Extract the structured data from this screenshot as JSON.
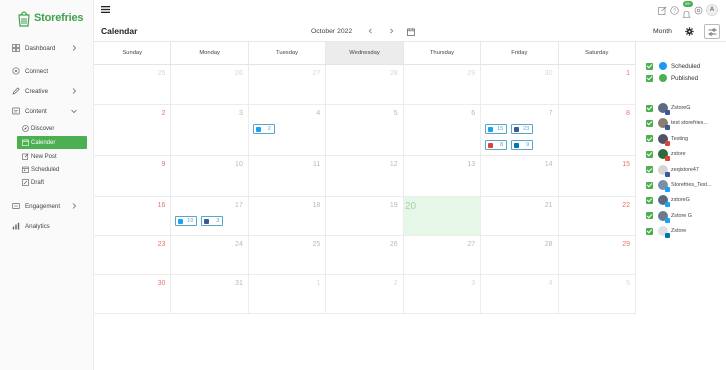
{
  "app": {
    "brand": "Storefries"
  },
  "colors": {
    "brand_green": "#4caf50",
    "weekend_red": "#e57373",
    "chip_blue": "#5aa7c4",
    "scheduled_blue": "#2196f3",
    "published_green": "#4caf50",
    "today_bg": "#e5f7e6"
  },
  "sidebar": {
    "items": [
      {
        "label": "Dashboard",
        "icon": "dashboard-icon",
        "has_chevron": true
      },
      {
        "label": "Connect",
        "icon": "connect-icon",
        "has_chevron": false
      },
      {
        "label": "Creative",
        "icon": "pencil-icon",
        "has_chevron": true
      },
      {
        "label": "Content",
        "icon": "content-icon",
        "has_chevron": true
      },
      {
        "label": "Engagement",
        "icon": "engagement-icon",
        "has_chevron": true
      },
      {
        "label": "Analytics",
        "icon": "analytics-icon",
        "has_chevron": false
      }
    ],
    "content_sub": [
      {
        "label": "Discover",
        "icon": "compass-icon",
        "active": false
      },
      {
        "label": "Calender",
        "icon": "calendar-icon",
        "active": true
      },
      {
        "label": "New Post",
        "icon": "edit-icon",
        "active": false
      },
      {
        "label": "Scheduled",
        "icon": "schedule-icon",
        "active": false
      },
      {
        "label": "Draft",
        "icon": "draft-icon",
        "active": false
      }
    ]
  },
  "topbar": {
    "notification_count": "99+",
    "avatar_initial": "A"
  },
  "header": {
    "title": "Calendar",
    "month": "October 2022",
    "view": "Month"
  },
  "calendar": {
    "weekdays": [
      "Sunday",
      "Monday",
      "Tuesday",
      "Wednesday",
      "Thursday",
      "Friday",
      "Saturday"
    ],
    "weeks": [
      [
        "25",
        "26",
        "27",
        "28",
        "29",
        "30",
        "1"
      ],
      [
        "2",
        "3",
        "4",
        "5",
        "6",
        "7",
        "8"
      ],
      [
        "9",
        "10",
        "11",
        "12",
        "13",
        "14",
        "15"
      ],
      [
        "16",
        "17",
        "18",
        "19",
        "20",
        "21",
        "22"
      ],
      [
        "23",
        "24",
        "25",
        "26",
        "27",
        "28",
        "29"
      ],
      [
        "30",
        "31",
        "1",
        "2",
        "3",
        "4",
        "5"
      ]
    ],
    "today": "20",
    "chips": [
      {
        "week": 1,
        "day": 2,
        "slot": 0,
        "network": "twitter",
        "count": "2"
      },
      {
        "week": 1,
        "day": 5,
        "slot": 0,
        "network": "twitter",
        "count": "15"
      },
      {
        "week": 1,
        "day": 5,
        "slot": 1,
        "network": "facebook",
        "count": "23"
      },
      {
        "week": 1,
        "day": 5,
        "slot": 2,
        "network": "google",
        "count": "8"
      },
      {
        "week": 1,
        "day": 5,
        "slot": 3,
        "network": "linkedin",
        "count": "9"
      },
      {
        "week": 3,
        "day": 1,
        "slot": 0,
        "network": "twitter",
        "count": "10"
      },
      {
        "week": 3,
        "day": 1,
        "slot": 1,
        "network": "facebook",
        "count": "3"
      }
    ]
  },
  "filters": {
    "statuses": [
      {
        "label": "Scheduled",
        "color": "#2196f3"
      },
      {
        "label": "Published",
        "color": "#4caf50"
      }
    ],
    "accounts": [
      {
        "label": "ZstoreG",
        "network": "facebook"
      },
      {
        "label": "test storefries...",
        "network": "facebook"
      },
      {
        "label": "Testing",
        "network": "google"
      },
      {
        "label": "zstore",
        "network": "google"
      },
      {
        "label": "zeqistore47",
        "network": "facebook"
      },
      {
        "label": "Storefries_Test...",
        "network": "twitter"
      },
      {
        "label": "zstoreG",
        "network": "twitter"
      },
      {
        "label": "Zstore G",
        "network": "twitter"
      },
      {
        "label": "Zstore",
        "network": "linkedin"
      }
    ]
  }
}
